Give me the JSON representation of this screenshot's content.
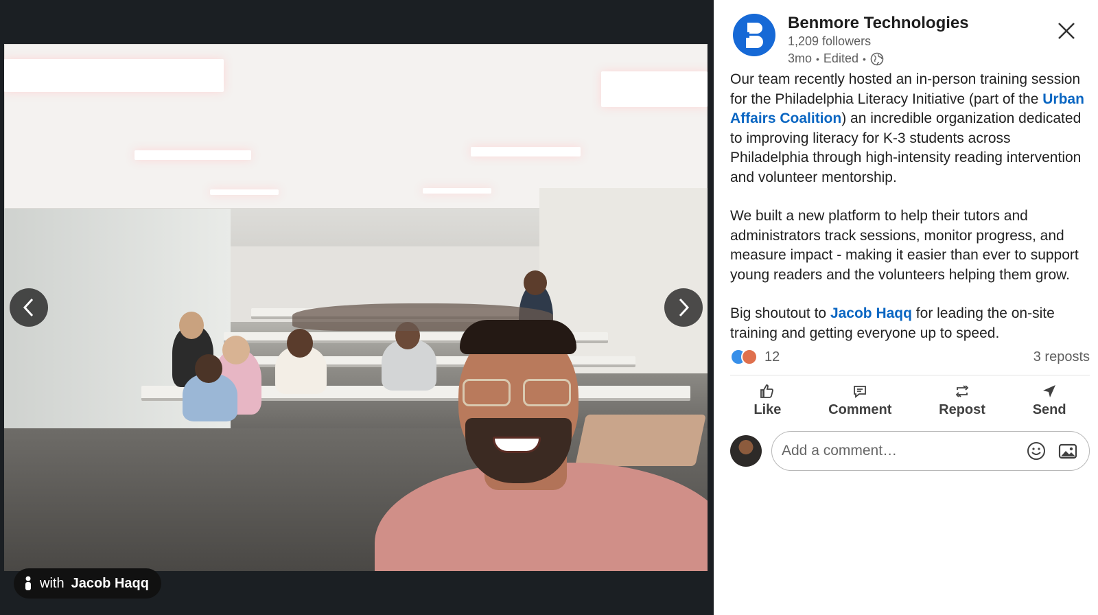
{
  "media": {
    "prev_label": "Previous",
    "next_label": "Next",
    "tag": {
      "prefix": "with",
      "name": "Jacob Haqq"
    }
  },
  "post": {
    "author": "Benmore Technologies",
    "followers": "1,209 followers",
    "time": "3mo",
    "edited": "Edited",
    "body": {
      "p1_a": "Our team recently hosted an in-person training session for the Philadelphia Literacy Initiative (part of the ",
      "p1_link": "Urban Affairs Coalition",
      "p1_b": ") an incredible organization dedicated to improving literacy for K-3 students across Philadelphia through high-intensity reading intervention and volunteer mentorship.",
      "p2": "We built a new platform to help their tutors and administrators track sessions, monitor progress, and measure impact - making it easier than ever to support young readers and the volunteers helping them grow.",
      "p3_a": "Big shoutout to ",
      "p3_link": "Jacob Haqq",
      "p3_b": " for leading the on-site training and getting everyone up to speed."
    },
    "reaction_count": "12",
    "reposts": "3 reposts"
  },
  "actions": {
    "like": "Like",
    "comment": "Comment",
    "repost": "Repost",
    "send": "Send"
  },
  "comment": {
    "placeholder": "Add a comment…"
  },
  "colors": {
    "brand": "#1669d6",
    "link": "#0a66c2",
    "like": "#378fe9",
    "love": "#df704d"
  }
}
